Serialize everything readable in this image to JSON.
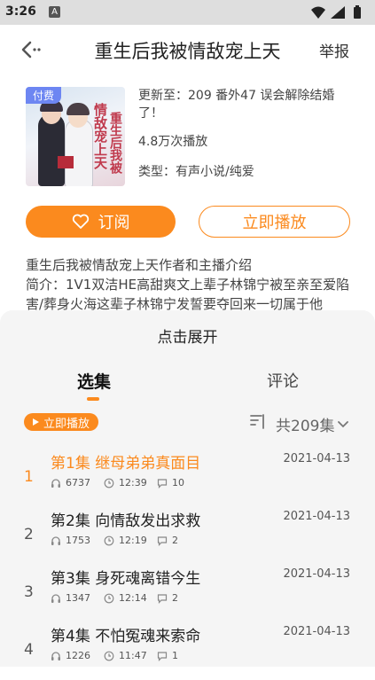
{
  "status_bar": {
    "time": "3:26",
    "notification_icon_label": "A"
  },
  "header": {
    "title": "重生后我被情敌宠上天",
    "report_label": "举报"
  },
  "book": {
    "cover_badge": "付费",
    "cover_title_main": "情敌宠上天",
    "cover_title_sub": "重生后我被",
    "update_text": "更新至：209 番外47 误会解除结婚了！",
    "plays_text": "4.8万次播放",
    "type_text": "类型：有声小说/纯爱"
  },
  "actions": {
    "subscribe_label": "订阅",
    "play_now_label": "立即播放"
  },
  "description": {
    "intro": "重生后我被情敌宠上天作者和主播介绍",
    "summary": "简介：1V1双洁HE高甜爽文上辈子林锦宁被至亲至爱陷害/葬身火海这辈子林锦宁发誓要夺回来一切属于他"
  },
  "sheet": {
    "expand_label": "点击展开",
    "tabs": [
      {
        "label": "选集"
      },
      {
        "label": "评论"
      }
    ],
    "mini_play_label": "立即播放",
    "total_label": "共209集"
  },
  "episodes": [
    {
      "index": "1",
      "title": "第1集 继母弟弟真面目",
      "date": "2021-04-13",
      "plays": "6737",
      "duration": "12:39",
      "comments": "10"
    },
    {
      "index": "2",
      "title": "第2集 向情敌发出求救",
      "date": "2021-04-13",
      "plays": "1753",
      "duration": "12:19",
      "comments": "2"
    },
    {
      "index": "3",
      "title": "第3集 身死魂离错今生",
      "date": "2021-04-13",
      "plays": "1347",
      "duration": "12:14",
      "comments": "2"
    },
    {
      "index": "4",
      "title": "第4集 不怕冤魂来索命",
      "date": "2021-04-13",
      "plays": "1226",
      "duration": "11:47",
      "comments": "1"
    }
  ],
  "colors": {
    "accent": "#fb8a1e",
    "sheet_bg": "#f5f5f5",
    "statusbar_bg": "#dedede"
  },
  "icons": [
    "back-icon",
    "heart-icon",
    "play-icon",
    "sort-icon",
    "chevron-down-icon",
    "headphones-icon",
    "clock-icon",
    "comment-icon",
    "wifi-icon",
    "signal-icon",
    "battery-icon"
  ]
}
